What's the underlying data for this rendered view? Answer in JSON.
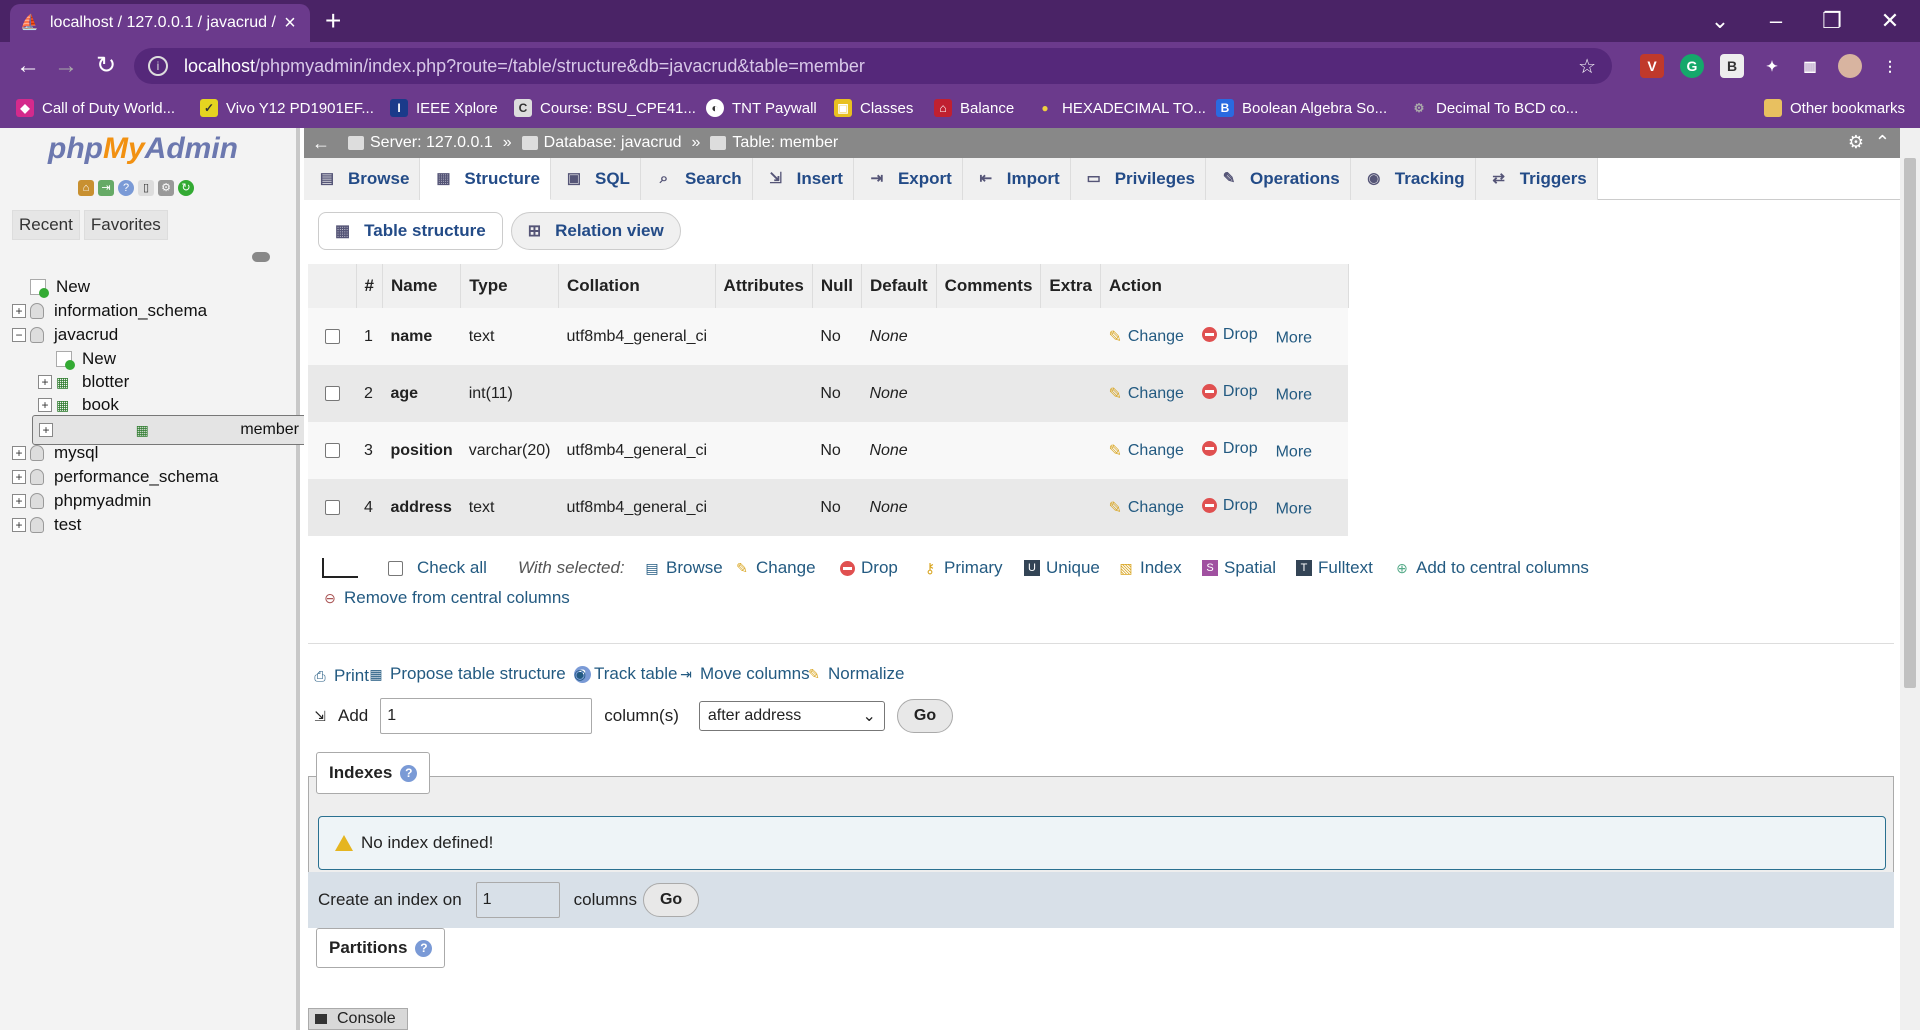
{
  "browser": {
    "tab_title": "localhost / 127.0.0.1 / javacrud / ...",
    "url_host": "localhost",
    "url_path": "/phpmyadmin/index.php?route=/table/structure&db=javacrud&table=member",
    "bookmarks": [
      "Call of Duty World...",
      "Vivo Y12 PD1901EF...",
      "IEEE Xplore",
      "Course: BSU_CPE41...",
      "TNT Paywall",
      "Classes",
      "Balance",
      "HEXADECIMAL TO...",
      "Boolean Algebra So...",
      "Decimal To BCD co..."
    ],
    "other_bookmarks": "Other bookmarks"
  },
  "sidebar": {
    "logo_php": "php",
    "logo_my": "My",
    "logo_admin": "Admin",
    "tabs": [
      "Recent",
      "Favorites"
    ],
    "tree": [
      "New",
      "information_schema",
      "javacrud",
      "New",
      "blotter",
      "book",
      "member",
      "mysql",
      "performance_schema",
      "phpmyadmin",
      "test"
    ]
  },
  "breadcrumb": {
    "server": "Server: 127.0.0.1",
    "database": "Database: javacrud",
    "table": "Table: member"
  },
  "tabs": [
    "Browse",
    "Structure",
    "SQL",
    "Search",
    "Insert",
    "Export",
    "Import",
    "Privileges",
    "Operations",
    "Tracking",
    "Triggers"
  ],
  "subtabs": [
    "Table structure",
    "Relation view"
  ],
  "structure": {
    "headers": [
      "#",
      "Name",
      "Type",
      "Collation",
      "Attributes",
      "Null",
      "Default",
      "Comments",
      "Extra",
      "Action"
    ],
    "rows": [
      {
        "num": "1",
        "name": "name",
        "type": "text",
        "collation": "utf8mb4_general_ci",
        "null": "No",
        "default": "None"
      },
      {
        "num": "2",
        "name": "age",
        "type": "int(11)",
        "collation": "",
        "null": "No",
        "default": "None"
      },
      {
        "num": "3",
        "name": "position",
        "type": "varchar(20)",
        "collation": "utf8mb4_general_ci",
        "null": "No",
        "default": "None"
      },
      {
        "num": "4",
        "name": "address",
        "type": "text",
        "collation": "utf8mb4_general_ci",
        "null": "No",
        "default": "None"
      }
    ],
    "action_change": "Change",
    "action_drop": "Drop",
    "action_more": "More"
  },
  "with_selected": {
    "check_all": "Check all",
    "label": "With selected:",
    "actions": [
      "Browse",
      "Change",
      "Drop",
      "Primary",
      "Unique",
      "Index",
      "Spatial",
      "Fulltext",
      "Add to central columns",
      "Remove from central columns"
    ]
  },
  "tools": {
    "print": "Print",
    "propose": "Propose table structure",
    "track": "Track table",
    "move": "Move columns",
    "normalize": "Normalize"
  },
  "add_columns": {
    "label": "Add",
    "count": "1",
    "suffix": "column(s)",
    "position": "after address",
    "go": "Go"
  },
  "indexes": {
    "title": "Indexes",
    "notice": "No index defined!",
    "create_label": "Create an index on",
    "create_count": "1",
    "create_suffix": "columns",
    "go": "Go"
  },
  "partitions": {
    "title": "Partitions"
  },
  "console": {
    "label": "Console"
  }
}
